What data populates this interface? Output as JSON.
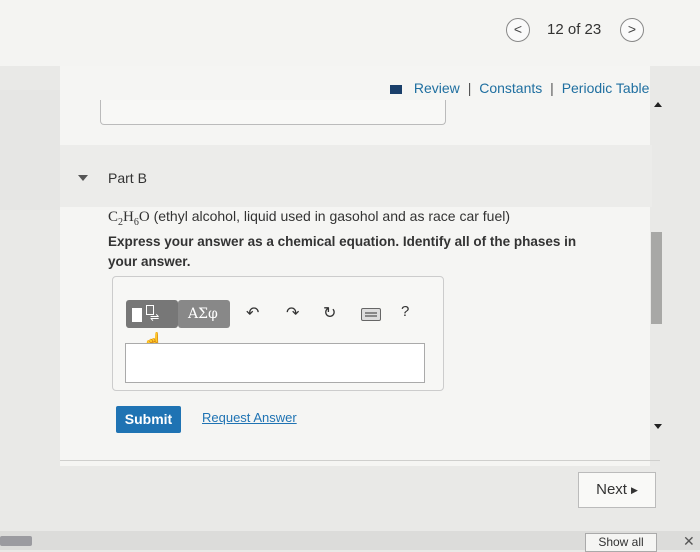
{
  "nav": {
    "prev_label": "<",
    "next_label": ">",
    "counter": "12 of 23"
  },
  "resources": {
    "review": "Review",
    "constants": "Constants",
    "periodic_table": "Periodic Table",
    "separator": "|"
  },
  "part": {
    "title": "Part B"
  },
  "problem": {
    "formula_c": "C",
    "formula_c_sub": "2",
    "formula_h": "H",
    "formula_h_sub": "6",
    "formula_o": "O",
    "description": " (ethyl alcohol, liquid used in gasohol and as race car fuel)"
  },
  "instruction": "Express your answer as a chemical equation. Identify all of the phases in your answer.",
  "toolbar": {
    "symbols_label": "ΑΣφ",
    "undo_icon": "↶",
    "redo_icon": "↷",
    "reset_icon": "↻",
    "help_label": "?"
  },
  "answer": {
    "value": ""
  },
  "actions": {
    "submit": "Submit",
    "request_answer": "Request Answer"
  },
  "footer": {
    "next": "Next",
    "show_all": "Show all",
    "close": "✕"
  }
}
